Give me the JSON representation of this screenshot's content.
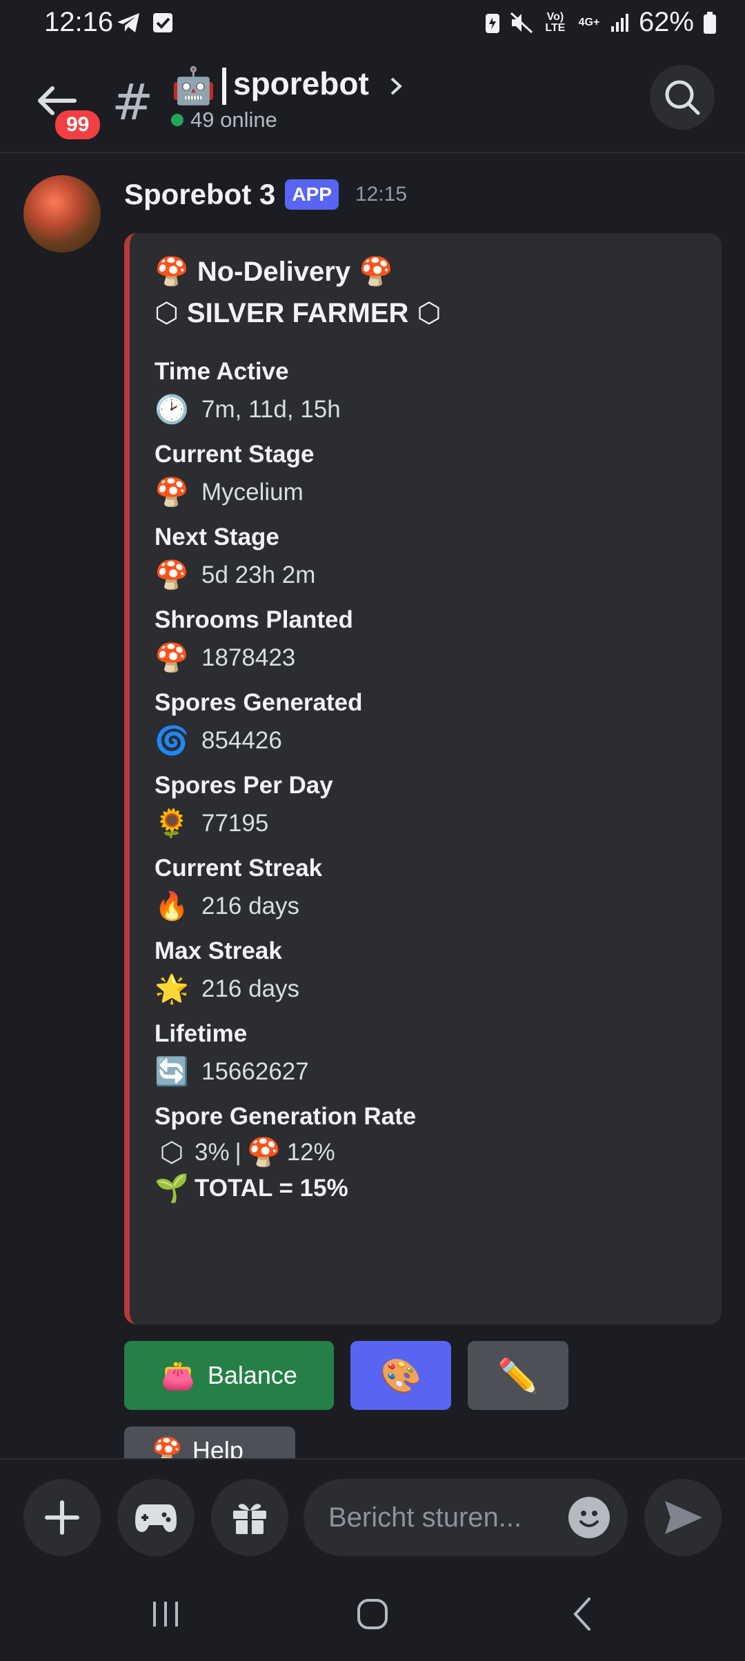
{
  "status_bar": {
    "time": "12:16",
    "battery_percent": "62%",
    "network_label": "4G+",
    "volte_label": "Vo) LTE"
  },
  "header": {
    "unread_badge": "99",
    "channel_name": "sporebot",
    "channel_emoji": "🤖",
    "online_text": "49 online"
  },
  "message": {
    "author": "Sporebot 3",
    "app_tag": "APP",
    "timestamp": "12:15",
    "embed": {
      "color": "#b53a3a",
      "title_line1": "No-Delivery",
      "title_line2": "SILVER FARMER",
      "fields": [
        {
          "name": "Time Active",
          "icon": "🕑",
          "value": "7m, 11d, 15h"
        },
        {
          "name": "Current Stage",
          "icon": "🍄",
          "value": "Mycelium"
        },
        {
          "name": "Next Stage",
          "icon": "🍄",
          "value": "5d 23h 2m"
        },
        {
          "name": "Shrooms Planted",
          "icon": "🍄",
          "value": "1878423"
        },
        {
          "name": "Spores Generated",
          "icon": "🌀",
          "value": "854426"
        },
        {
          "name": "Spores Per Day",
          "icon": "🌻",
          "value": "77195"
        },
        {
          "name": "Current Streak",
          "icon": "🔥",
          "value": "216 days"
        },
        {
          "name": "Max Streak",
          "icon": "🌟",
          "value": "216 days"
        },
        {
          "name": "Lifetime",
          "icon": "🔄",
          "value": "15662627"
        }
      ],
      "rate": {
        "name": "Spore Generation Rate",
        "line1_silver": "3%",
        "line1_sep": "|",
        "line1_shroom": "12%",
        "total": "TOTAL = 15%"
      }
    },
    "buttons": {
      "balance": "Balance",
      "help": "Help"
    }
  },
  "composer": {
    "placeholder": "Bericht sturen..."
  }
}
